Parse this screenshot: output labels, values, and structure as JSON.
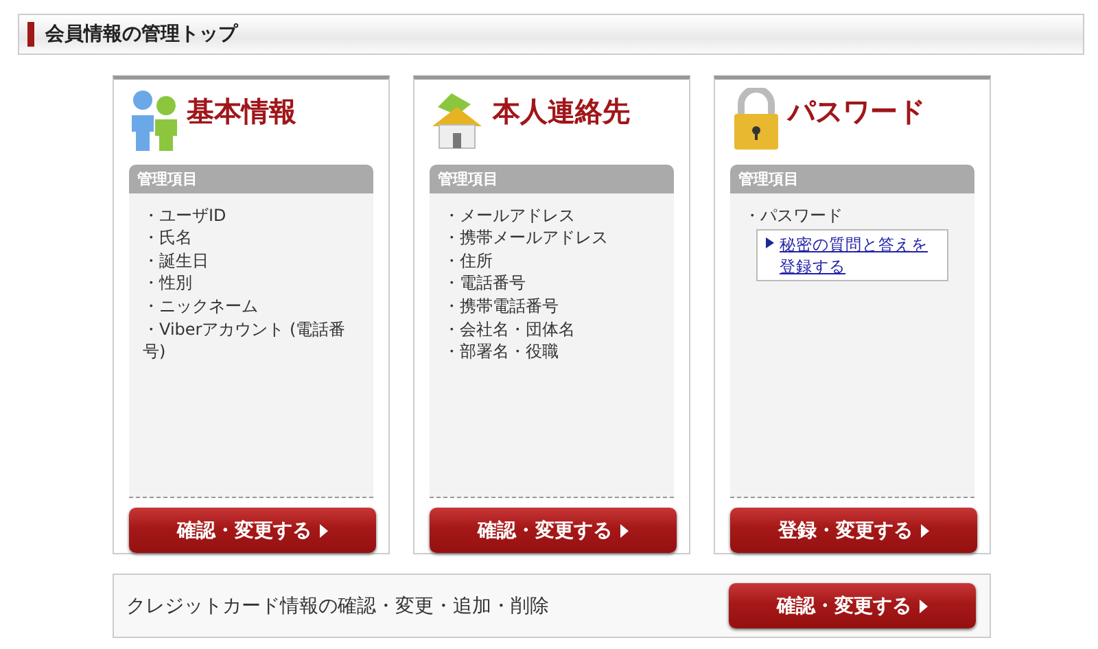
{
  "page_title": "会員情報の管理トップ",
  "cards": [
    {
      "kind": "people",
      "title": "基本情報",
      "section_label": "管理項目",
      "items": [
        "・ユーザID",
        "・氏名",
        "・誕生日",
        "・性別",
        "・ニックネーム",
        "・Viberアカウント (電話番号)"
      ],
      "button": "確認・変更する"
    },
    {
      "kind": "house",
      "title": "本人連絡先",
      "section_label": "管理項目",
      "items": [
        "・メールアドレス",
        "・携帯メールアドレス",
        "・住所",
        "・電話番号",
        "・携帯電話番号",
        "・会社名・団体名",
        "・部署名・役職"
      ],
      "button": "確認・変更する"
    },
    {
      "kind": "lock",
      "title": "パスワード",
      "section_label": "管理項目",
      "items": [
        "・パスワード"
      ],
      "link": "秘密の質問と答えを登録する",
      "button": "登録・変更する"
    }
  ],
  "credit": {
    "text": "クレジットカード情報の確認・変更・追加・削除",
    "button": "確認・変更する"
  }
}
